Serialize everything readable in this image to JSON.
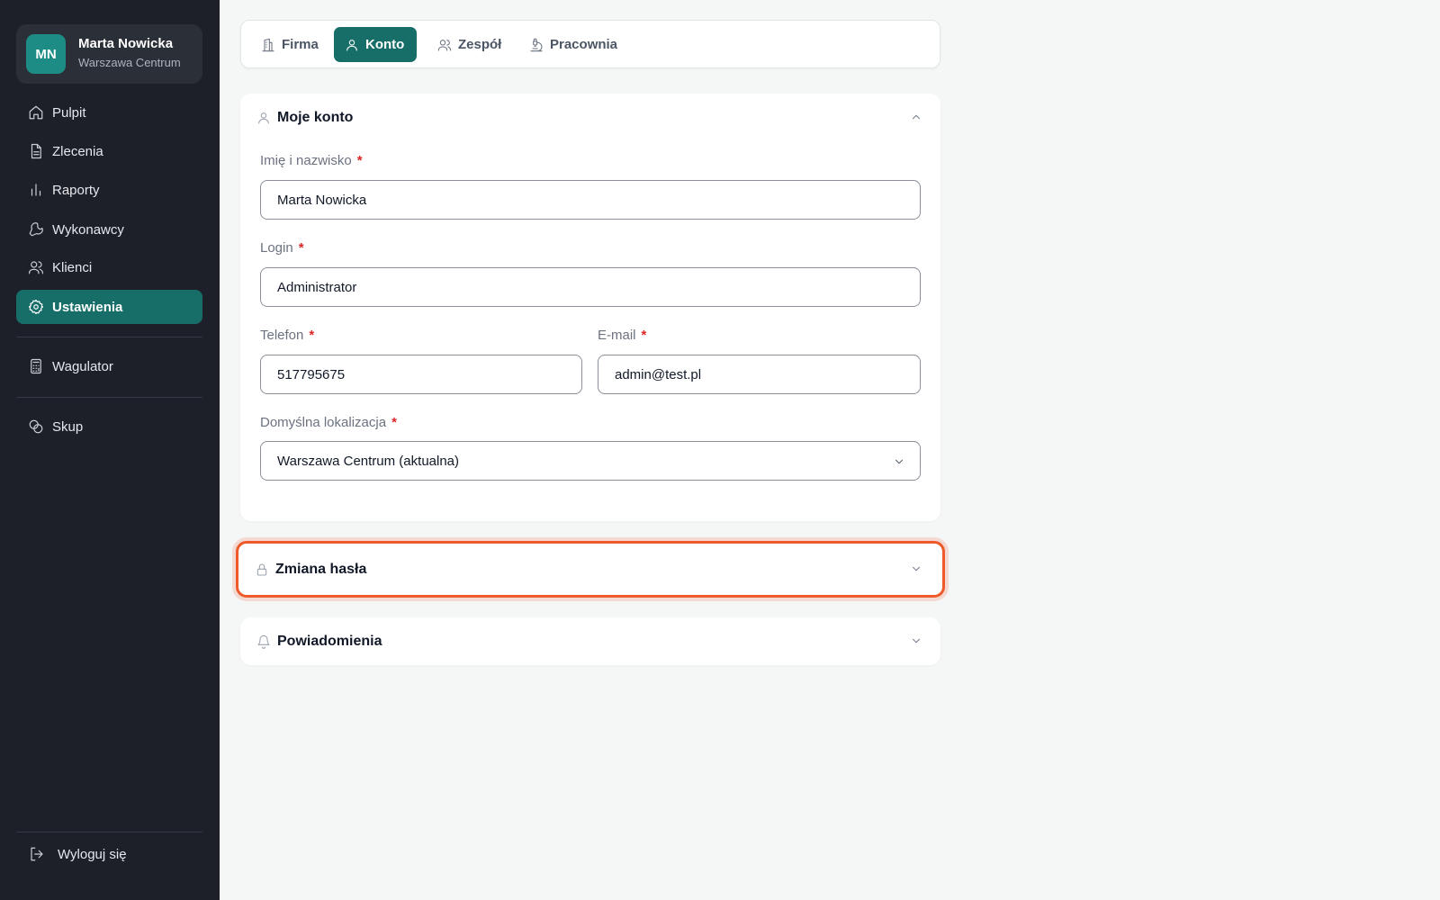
{
  "user": {
    "initials": "MN",
    "name": "Marta Nowicka",
    "location": "Warszawa Centrum"
  },
  "sidebar": {
    "items": [
      {
        "label": "Pulpit",
        "icon": "home-icon"
      },
      {
        "label": "Zlecenia",
        "icon": "document-icon"
      },
      {
        "label": "Raporty",
        "icon": "bar-chart-icon"
      },
      {
        "label": "Wykonawcy",
        "icon": "wrench-icon"
      },
      {
        "label": "Klienci",
        "icon": "users-icon"
      },
      {
        "label": "Ustawienia",
        "icon": "gear-icon",
        "active": true
      },
      {
        "label": "Wagulator",
        "icon": "calculator-icon"
      },
      {
        "label": "Skup",
        "icon": "coins-icon"
      }
    ],
    "logout": {
      "label": "Wyloguj się",
      "icon": "logout-icon"
    }
  },
  "tabs": [
    {
      "label": "Firma",
      "icon": "building-icon"
    },
    {
      "label": "Konto",
      "icon": "user-icon",
      "active": true
    },
    {
      "label": "Zespół",
      "icon": "users-icon"
    },
    {
      "label": "Pracownia",
      "icon": "microscope-icon"
    }
  ],
  "account_section": {
    "title": "Moje konto",
    "fields": {
      "name": {
        "label": "Imię i nazwisko",
        "required": "*",
        "value": "Marta Nowicka"
      },
      "login": {
        "label": "Login",
        "required": "*",
        "value": "Administrator"
      },
      "phone": {
        "label": "Telefon",
        "required": "*",
        "value": "517795675"
      },
      "email": {
        "label": "E-mail",
        "required": "*",
        "value": "admin@test.pl"
      },
      "location": {
        "label": "Domyślna lokalizacja",
        "required": "*",
        "value": "Warszawa Centrum (aktualna)"
      }
    }
  },
  "password_section": {
    "title": "Zmiana hasła"
  },
  "notifications_section": {
    "title": "Powiadomienia"
  },
  "colors": {
    "sidebar_bg": "#1d2029",
    "accent": "#176e69",
    "avatar": "#1c8c85",
    "highlight": "#ee5a2a",
    "required": "#dc2626"
  }
}
